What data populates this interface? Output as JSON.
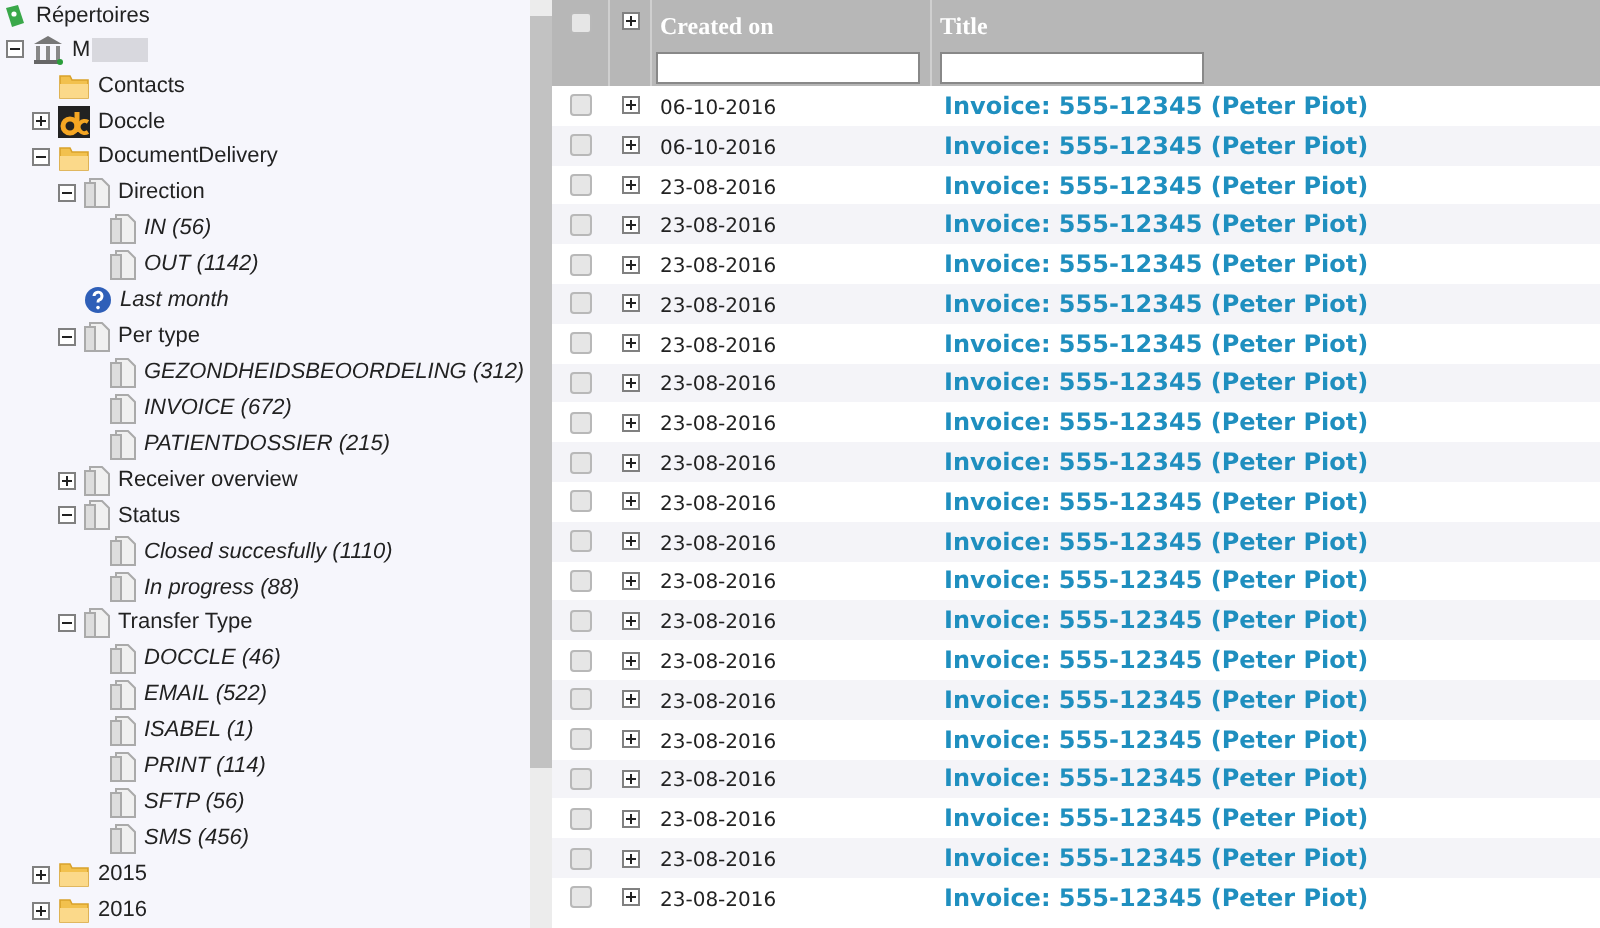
{
  "sidebar": {
    "title": "Répertoires",
    "tree": [
      {
        "label": "M",
        "kind": "bank",
        "redacted": true,
        "expanded": true,
        "children": [
          {
            "label": "Contacts",
            "kind": "folder"
          },
          {
            "label": "Doccle",
            "kind": "doccle",
            "expanded": false
          },
          {
            "label": "DocumentDelivery",
            "kind": "folder",
            "expanded": true,
            "children": [
              {
                "label": "Direction",
                "kind": "doc",
                "expanded": true,
                "children": [
                  {
                    "label": "IN (56)",
                    "kind": "filter"
                  },
                  {
                    "label": "OUT (1142)",
                    "kind": "filter"
                  }
                ]
              },
              {
                "label": "Last month",
                "kind": "help"
              },
              {
                "label": "Per type",
                "kind": "doc",
                "expanded": true,
                "children": [
                  {
                    "label": "GEZONDHEIDSBEOORDELING (312)",
                    "kind": "filter"
                  },
                  {
                    "label": "INVOICE (672)",
                    "kind": "filter"
                  },
                  {
                    "label": "PATIENTDOSSIER (215)",
                    "kind": "filter"
                  }
                ]
              },
              {
                "label": "Receiver overview",
                "kind": "doc",
                "expanded": false
              },
              {
                "label": "Status",
                "kind": "doc",
                "expanded": true,
                "children": [
                  {
                    "label": "Closed succesfully (1110)",
                    "kind": "filter"
                  },
                  {
                    "label": "In progress (88)",
                    "kind": "filter"
                  }
                ]
              },
              {
                "label": "Transfer Type",
                "kind": "doc",
                "expanded": true,
                "children": [
                  {
                    "label": "DOCCLE (46)",
                    "kind": "filter"
                  },
                  {
                    "label": "EMAIL (522)",
                    "kind": "filter"
                  },
                  {
                    "label": "ISABEL (1)",
                    "kind": "filter"
                  },
                  {
                    "label": "PRINT (114)",
                    "kind": "filter"
                  },
                  {
                    "label": "SFTP (56)",
                    "kind": "filter"
                  },
                  {
                    "label": "SMS (456)",
                    "kind": "filter"
                  }
                ]
              }
            ]
          },
          {
            "label": "2015",
            "kind": "folder",
            "expanded": false
          },
          {
            "label": "2016",
            "kind": "folder",
            "expanded": false
          }
        ]
      }
    ]
  },
  "table": {
    "header_checked": false,
    "columns": [
      "Created on",
      "Title"
    ],
    "rows": [
      {
        "checked": false,
        "expanded": false,
        "created_on": "06-10-2016",
        "title": "Invoice: 555-12345 (Peter Piot)"
      },
      {
        "checked": false,
        "expanded": false,
        "created_on": "06-10-2016",
        "title": "Invoice: 555-12345 (Peter Piot)"
      },
      {
        "checked": false,
        "expanded": false,
        "created_on": "23-08-2016",
        "title": "Invoice: 555-12345 (Peter Piot)"
      },
      {
        "checked": false,
        "expanded": false,
        "created_on": "23-08-2016",
        "title": "Invoice: 555-12345 (Peter Piot)"
      },
      {
        "checked": false,
        "expanded": false,
        "created_on": "23-08-2016",
        "title": "Invoice: 555-12345 (Peter Piot)"
      },
      {
        "checked": false,
        "expanded": false,
        "created_on": "23-08-2016",
        "title": "Invoice: 555-12345 (Peter Piot)"
      },
      {
        "checked": false,
        "expanded": false,
        "created_on": "23-08-2016",
        "title": "Invoice: 555-12345 (Peter Piot)"
      },
      {
        "checked": false,
        "expanded": false,
        "created_on": "23-08-2016",
        "title": "Invoice: 555-12345 (Peter Piot)"
      },
      {
        "checked": false,
        "expanded": false,
        "created_on": "23-08-2016",
        "title": "Invoice: 555-12345 (Peter Piot)"
      },
      {
        "checked": false,
        "expanded": false,
        "created_on": "23-08-2016",
        "title": "Invoice: 555-12345 (Peter Piot)"
      },
      {
        "checked": false,
        "expanded": false,
        "created_on": "23-08-2016",
        "title": "Invoice: 555-12345 (Peter Piot)"
      },
      {
        "checked": false,
        "expanded": false,
        "created_on": "23-08-2016",
        "title": "Invoice: 555-12345 (Peter Piot)"
      },
      {
        "checked": false,
        "expanded": false,
        "created_on": "23-08-2016",
        "title": "Invoice: 555-12345 (Peter Piot)"
      },
      {
        "checked": false,
        "expanded": false,
        "created_on": "23-08-2016",
        "title": "Invoice: 555-12345 (Peter Piot)"
      },
      {
        "checked": false,
        "expanded": false,
        "created_on": "23-08-2016",
        "title": "Invoice: 555-12345 (Peter Piot)"
      },
      {
        "checked": false,
        "expanded": false,
        "created_on": "23-08-2016",
        "title": "Invoice: 555-12345 (Peter Piot)"
      },
      {
        "checked": false,
        "expanded": false,
        "created_on": "23-08-2016",
        "title": "Invoice: 555-12345 (Peter Piot)"
      },
      {
        "checked": false,
        "expanded": false,
        "created_on": "23-08-2016",
        "title": "Invoice: 555-12345 (Peter Piot)"
      },
      {
        "checked": false,
        "expanded": false,
        "created_on": "23-08-2016",
        "title": "Invoice: 555-12345 (Peter Piot)"
      },
      {
        "checked": false,
        "expanded": false,
        "created_on": "23-08-2016",
        "title": "Invoice: 555-12345 (Peter Piot)"
      },
      {
        "checked": false,
        "expanded": false,
        "created_on": "23-08-2016",
        "title": "Invoice: 555-12345 (Peter Piot)"
      }
    ]
  }
}
